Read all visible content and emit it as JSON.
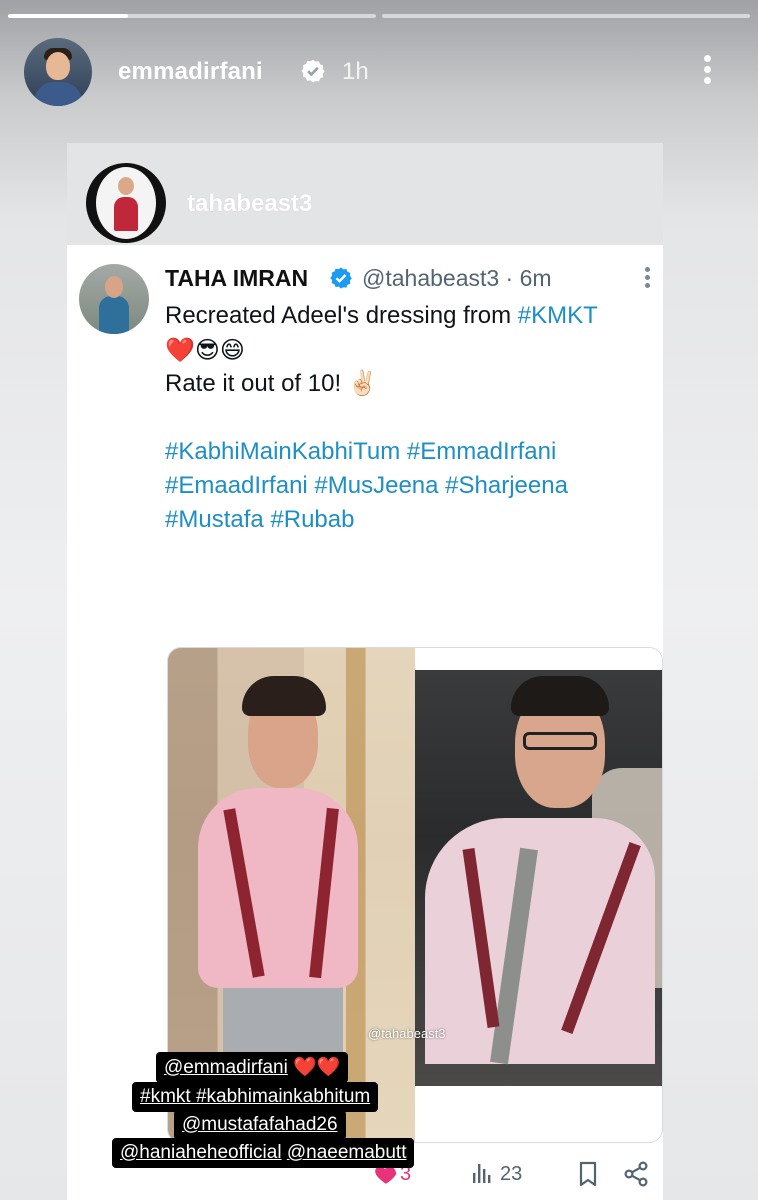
{
  "story": {
    "username": "emmadirfani",
    "time": "1h",
    "progress_fraction": 0.33
  },
  "repost": {
    "username": "tahabeast3"
  },
  "tweet": {
    "name": "TAHA IMRAN",
    "handle": "@tahabeast3 · 6m",
    "text_line1_prefix": "Recreated Adeel's dressing from ",
    "text_line1_hashtag": "#KMKT",
    "emojis": "❤️😎😄",
    "text_line3": "Rate it out of 10! ✌🏻",
    "hashtags_line1": "#KabhiMainKabhiTum #EmmadIrfani",
    "hashtags_line2": "#EmaadIrfani #MusJeena #Sharjeena",
    "hashtags_line3": "#Mustafa #Rubab",
    "image_watermark": "@tahabeast3",
    "likes": "3",
    "views": "23"
  },
  "caption": {
    "line1": "@emmadirfani",
    "line1_emoji": "❤️❤️",
    "line2": "#kmkt #kabhimainkabhitum",
    "line3": "@mustafafahad26",
    "line4a": "@haniaheheofficial",
    "line4b": "@naeemabutt"
  },
  "colors": {
    "hashtag": "#1d8fc4",
    "verified": "#1d9bf0",
    "like": "#e8327a"
  },
  "icons": [
    "verified-badge-icon",
    "more-vertical-icon",
    "heart-icon",
    "views-icon",
    "bookmark-icon",
    "share-icon"
  ]
}
